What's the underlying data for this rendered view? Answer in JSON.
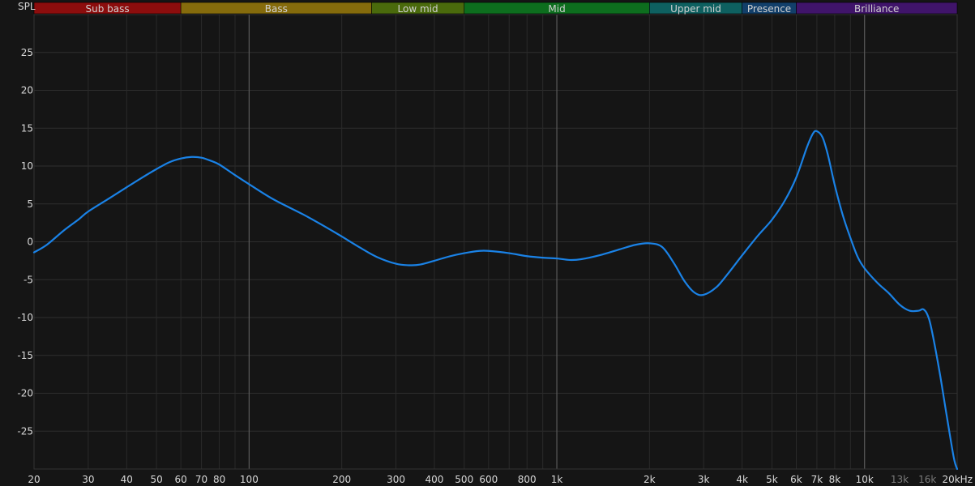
{
  "chart_data": {
    "type": "line",
    "ylabel": "SPL",
    "xscale": "log",
    "xlim": [
      20,
      20000
    ],
    "ylim": [
      -30,
      30
    ],
    "grid": true,
    "x_tick_labels": [
      {
        "value": 20,
        "label": "20"
      },
      {
        "value": 30,
        "label": "30"
      },
      {
        "value": 40,
        "label": "40"
      },
      {
        "value": 50,
        "label": "50"
      },
      {
        "value": 60,
        "label": "60"
      },
      {
        "value": 70,
        "label": "70"
      },
      {
        "value": 80,
        "label": "80"
      },
      {
        "value": 100,
        "label": "100"
      },
      {
        "value": 200,
        "label": "200"
      },
      {
        "value": 300,
        "label": "300"
      },
      {
        "value": 400,
        "label": "400"
      },
      {
        "value": 500,
        "label": "500"
      },
      {
        "value": 600,
        "label": "600"
      },
      {
        "value": 800,
        "label": "800"
      },
      {
        "value": 1000,
        "label": "1k"
      },
      {
        "value": 2000,
        "label": "2k"
      },
      {
        "value": 3000,
        "label": "3k"
      },
      {
        "value": 4000,
        "label": "4k"
      },
      {
        "value": 5000,
        "label": "5k"
      },
      {
        "value": 6000,
        "label": "6k"
      },
      {
        "value": 7000,
        "label": "7k"
      },
      {
        "value": 8000,
        "label": "8k"
      },
      {
        "value": 10000,
        "label": "10k"
      },
      {
        "value": 13000,
        "label": "13k",
        "dim": true
      },
      {
        "value": 16000,
        "label": "16k",
        "dim": true
      },
      {
        "value": 20000,
        "label": "20kHz"
      }
    ],
    "y_ticks": [
      25,
      20,
      15,
      10,
      5,
      0,
      -5,
      -10,
      -15,
      -20,
      -25
    ],
    "bands": [
      {
        "name": "Sub bass",
        "from": 20,
        "to": 60,
        "color": "#8c0d0d"
      },
      {
        "name": "Bass",
        "from": 60,
        "to": 250,
        "color": "#856b0c"
      },
      {
        "name": "Low mid",
        "from": 250,
        "to": 500,
        "color": "#4a6a0c"
      },
      {
        "name": "Mid",
        "from": 500,
        "to": 2000,
        "color": "#0d6e1e"
      },
      {
        "name": "Upper mid",
        "from": 2000,
        "to": 4000,
        "color": "#0e6060"
      },
      {
        "name": "Presence",
        "from": 4000,
        "to": 6000,
        "color": "#123f6a"
      },
      {
        "name": "Brilliance",
        "from": 6000,
        "to": 20000,
        "color": "#40146a"
      }
    ],
    "series": [
      {
        "color": "#1a82e6",
        "points": [
          [
            20,
            -1.4
          ],
          [
            22,
            -0.4
          ],
          [
            25,
            1.5
          ],
          [
            28,
            3.0
          ],
          [
            30,
            4.0
          ],
          [
            35,
            5.7
          ],
          [
            40,
            7.2
          ],
          [
            45,
            8.5
          ],
          [
            50,
            9.6
          ],
          [
            55,
            10.5
          ],
          [
            60,
            11.0
          ],
          [
            65,
            11.2
          ],
          [
            70,
            11.1
          ],
          [
            75,
            10.7
          ],
          [
            80,
            10.2
          ],
          [
            90,
            8.8
          ],
          [
            100,
            7.6
          ],
          [
            120,
            5.6
          ],
          [
            150,
            3.6
          ],
          [
            180,
            1.8
          ],
          [
            200,
            0.7
          ],
          [
            230,
            -0.8
          ],
          [
            260,
            -2.0
          ],
          [
            300,
            -2.9
          ],
          [
            330,
            -3.1
          ],
          [
            360,
            -3.0
          ],
          [
            400,
            -2.5
          ],
          [
            450,
            -1.9
          ],
          [
            500,
            -1.5
          ],
          [
            560,
            -1.2
          ],
          [
            600,
            -1.2
          ],
          [
            700,
            -1.5
          ],
          [
            800,
            -1.9
          ],
          [
            900,
            -2.1
          ],
          [
            1000,
            -2.2
          ],
          [
            1100,
            -2.4
          ],
          [
            1200,
            -2.3
          ],
          [
            1400,
            -1.7
          ],
          [
            1600,
            -1.0
          ],
          [
            1800,
            -0.4
          ],
          [
            2000,
            -0.2
          ],
          [
            2200,
            -0.7
          ],
          [
            2400,
            -2.8
          ],
          [
            2600,
            -5.2
          ],
          [
            2800,
            -6.7
          ],
          [
            3000,
            -7.0
          ],
          [
            3300,
            -6.0
          ],
          [
            3600,
            -4.2
          ],
          [
            4000,
            -1.8
          ],
          [
            4500,
            0.8
          ],
          [
            5000,
            2.9
          ],
          [
            5500,
            5.4
          ],
          [
            6000,
            8.5
          ],
          [
            6500,
            12.5
          ],
          [
            6800,
            14.3
          ],
          [
            7000,
            14.6
          ],
          [
            7300,
            13.8
          ],
          [
            7600,
            11.5
          ],
          [
            8000,
            7.5
          ],
          [
            8500,
            3.5
          ],
          [
            9000,
            0.5
          ],
          [
            9500,
            -2.0
          ],
          [
            10000,
            -3.5
          ],
          [
            11000,
            -5.4
          ],
          [
            12000,
            -6.8
          ],
          [
            13000,
            -8.3
          ],
          [
            14000,
            -9.1
          ],
          [
            15000,
            -9.1
          ],
          [
            15500,
            -8.9
          ],
          [
            16000,
            -9.6
          ],
          [
            16500,
            -11.5
          ],
          [
            17500,
            -17.0
          ],
          [
            18500,
            -23.0
          ],
          [
            19500,
            -28.5
          ],
          [
            20000,
            -30.0
          ]
        ]
      }
    ]
  }
}
